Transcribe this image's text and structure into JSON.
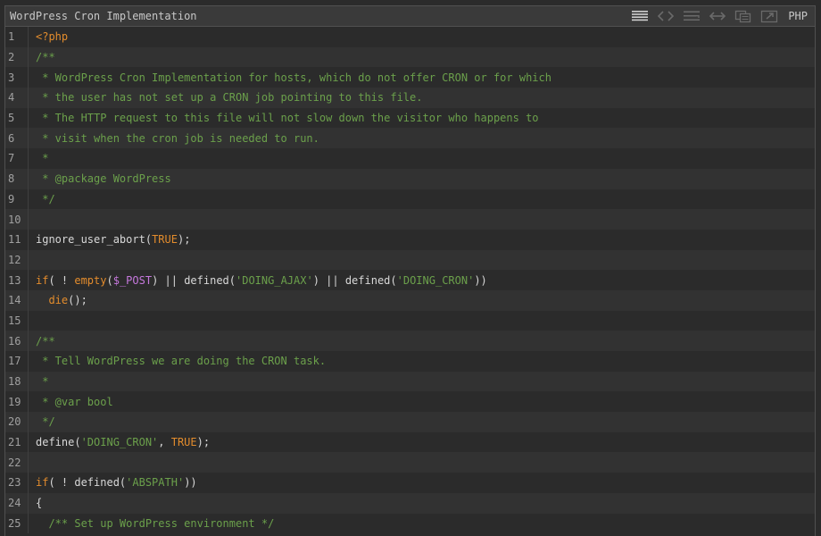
{
  "header": {
    "title": "WordPress Cron Implementation",
    "language": "PHP",
    "tools": [
      {
        "name": "view-source-icon"
      },
      {
        "name": "embed-code-icon"
      },
      {
        "name": "wrap-lines-icon"
      },
      {
        "name": "expand-width-icon"
      },
      {
        "name": "copy-icon"
      },
      {
        "name": "open-new-window-icon"
      }
    ]
  },
  "colors": {
    "background": "#2b2b2b",
    "alt_row": "#323232",
    "header": "#3a3a3a",
    "keyword": "#e38c2c",
    "comment": "#6ba04b",
    "string": "#6ba04b",
    "text": "#d8d8d8",
    "line_number": "#a0a0a0"
  },
  "lines": [
    {
      "n": "1",
      "tokens": [
        {
          "t": "<?php",
          "c": "kw"
        }
      ]
    },
    {
      "n": "2",
      "tokens": [
        {
          "t": "/**",
          "c": "cm"
        }
      ]
    },
    {
      "n": "3",
      "tokens": [
        {
          "t": " * WordPress Cron Implementation for hosts, which do not offer CRON or for which",
          "c": "cm"
        }
      ]
    },
    {
      "n": "4",
      "tokens": [
        {
          "t": " * the user has not set up a CRON job pointing to this file.",
          "c": "cm"
        }
      ]
    },
    {
      "n": "5",
      "tokens": [
        {
          "t": " * The HTTP request to this file will not slow down the visitor who happens to",
          "c": "cm"
        }
      ]
    },
    {
      "n": "6",
      "tokens": [
        {
          "t": " * visit when the cron job is needed to run.",
          "c": "cm"
        }
      ]
    },
    {
      "n": "7",
      "tokens": [
        {
          "t": " *",
          "c": "cm"
        }
      ]
    },
    {
      "n": "8",
      "tokens": [
        {
          "t": " * @package WordPress",
          "c": "cm"
        }
      ]
    },
    {
      "n": "9",
      "tokens": [
        {
          "t": " */",
          "c": "cm"
        }
      ]
    },
    {
      "n": "10",
      "tokens": []
    },
    {
      "n": "11",
      "tokens": [
        {
          "t": "ignore_user_abort",
          "c": "plain"
        },
        {
          "t": "(",
          "c": "plain"
        },
        {
          "t": "TRUE",
          "c": "const"
        },
        {
          "t": ");",
          "c": "plain"
        }
      ]
    },
    {
      "n": "12",
      "tokens": []
    },
    {
      "n": "13",
      "tokens": [
        {
          "t": "if",
          "c": "kw"
        },
        {
          "t": "( ! ",
          "c": "plain"
        },
        {
          "t": "empty",
          "c": "fn"
        },
        {
          "t": "(",
          "c": "plain"
        },
        {
          "t": "$_POST",
          "c": "var"
        },
        {
          "t": ") || defined(",
          "c": "plain"
        },
        {
          "t": "'DOING_AJAX'",
          "c": "str"
        },
        {
          "t": ") || defined(",
          "c": "plain"
        },
        {
          "t": "'DOING_CRON'",
          "c": "str"
        },
        {
          "t": "))",
          "c": "plain"
        }
      ]
    },
    {
      "n": "14",
      "tokens": [
        {
          "t": "  ",
          "c": "plain"
        },
        {
          "t": "die",
          "c": "fn"
        },
        {
          "t": "();",
          "c": "plain"
        }
      ]
    },
    {
      "n": "15",
      "tokens": []
    },
    {
      "n": "16",
      "tokens": [
        {
          "t": "/**",
          "c": "cm"
        }
      ]
    },
    {
      "n": "17",
      "tokens": [
        {
          "t": " * Tell WordPress we are doing the CRON task.",
          "c": "cm"
        }
      ]
    },
    {
      "n": "18",
      "tokens": [
        {
          "t": " *",
          "c": "cm"
        }
      ]
    },
    {
      "n": "19",
      "tokens": [
        {
          "t": " * @var bool",
          "c": "cm"
        }
      ]
    },
    {
      "n": "20",
      "tokens": [
        {
          "t": " */",
          "c": "cm"
        }
      ]
    },
    {
      "n": "21",
      "tokens": [
        {
          "t": "define(",
          "c": "plain"
        },
        {
          "t": "'DOING_CRON'",
          "c": "str"
        },
        {
          "t": ", ",
          "c": "plain"
        },
        {
          "t": "TRUE",
          "c": "const"
        },
        {
          "t": ");",
          "c": "plain"
        }
      ]
    },
    {
      "n": "22",
      "tokens": []
    },
    {
      "n": "23",
      "tokens": [
        {
          "t": "if",
          "c": "kw"
        },
        {
          "t": "( ! defined(",
          "c": "plain"
        },
        {
          "t": "'ABSPATH'",
          "c": "str"
        },
        {
          "t": "))",
          "c": "plain"
        }
      ]
    },
    {
      "n": "24",
      "tokens": [
        {
          "t": "{",
          "c": "plain"
        }
      ]
    },
    {
      "n": "25",
      "tokens": [
        {
          "t": "  ",
          "c": "plain"
        },
        {
          "t": "/** Set up WordPress environment */",
          "c": "cm"
        }
      ]
    }
  ]
}
